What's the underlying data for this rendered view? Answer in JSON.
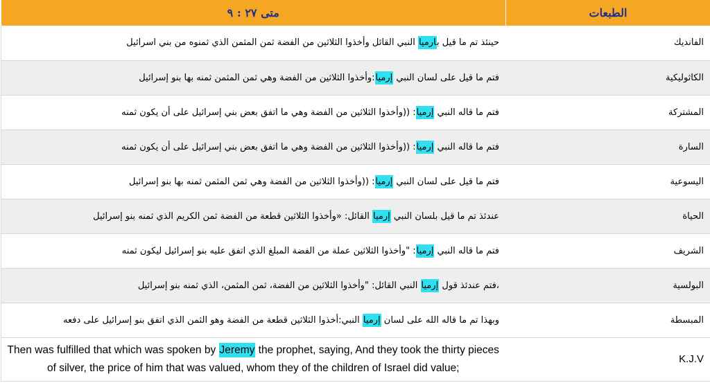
{
  "header": {
    "editions_label": "الطبعات",
    "reference_label": "متى ٢٧ : ٩"
  },
  "colors": {
    "header_bg": "#f5a623",
    "header_text": "#1f2f8f",
    "highlight": "#2ee0f0",
    "alt_row": "#eeeeee"
  },
  "rows": [
    {
      "edition": "الفانديك",
      "before": "حينئذ تم ما قيل ب",
      "highlight": "ارميا",
      "after": " النبي القائل وأخذوا الثلاثين من الفضة ثمن المثمن الذي ثمنوه من بني اسرائيل"
    },
    {
      "edition": "الكاثوليكية",
      "before": "فتم ما قيل على لسان النبي ",
      "highlight": "إرميا",
      "after": ":وأخذوا الثلاثين من الفضة وهي ثمن المثمن ثمنه بها بنو إسرائيل"
    },
    {
      "edition": "المشتركة",
      "before": "فتم ما قاله النبي ",
      "highlight": "إرميا",
      "after": ": ((وأخذوا الثلاثين من الفضة  وهي ما اتفق بعض بني إسرائيل على أن يكون ثمنه"
    },
    {
      "edition": "السارة",
      "before": "فتم ما قاله النبي ",
      "highlight": "إرميا",
      "after": ": ((وأخذوا الثلاثين من الفضة  وهي ما اتفق بعض بني إسرائيل على أن يكون ثمنه"
    },
    {
      "edition": "اليسوعية",
      "before": "فتم ما قيل على لسان النبي ",
      "highlight": "إرميا",
      "after": ": ((وأخذوا الثلاثين من الفضة وهي ثمن المثمن ثمنه بها بنو إسرائيل"
    },
    {
      "edition": "الحياة",
      "before": "عندئذ تم ما قيل بلسان النبي ",
      "highlight": "إرميا",
      "after": " القائل: «وأخذوا الثلاثين قطعة من الفضة  ثمن الكريم الذي ثمنه بنو إسرائيل"
    },
    {
      "edition": "الشريف",
      "before": "فتم ما قاله النبي ",
      "highlight": "إرميا",
      "after": ": \"وأخذوا الثلاثين عملة من الفضة  المبلغ الذي اتفق عليه بنو إسرائيل ليكون ثمنه"
    },
    {
      "edition": "البولسية",
      "before": "،فتم عندئذ قول ",
      "highlight": "إرميا",
      "after": " النبي القائل: \"وأخذوا الثلاثين من الفضة، ثمن المثمن، الذي ثمنه بنو إسرائيل"
    },
    {
      "edition": "المبسطة",
      "before": "وبهذا تم ما قاله الله على لسان ",
      "highlight": "إرميا",
      "after": " النبي:أخذوا الثلاثين قطعة من الفضة  وهو الثمن الذي اتفق بنو إسرائيل على دفعه"
    }
  ],
  "kjv": {
    "edition": "K.J.V",
    "before": "Then was fulfilled that which was spoken by ",
    "highlight": "Jeremy",
    "after": " the prophet, saying, And they took the thirty pieces of silver, the price of him that was valued, whom they of the children of Israel did value;"
  }
}
